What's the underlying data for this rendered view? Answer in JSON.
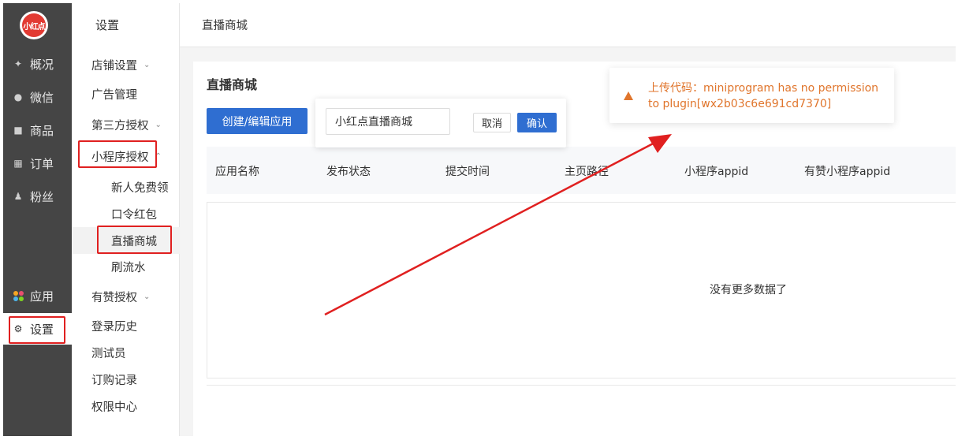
{
  "app": {
    "logo_text": "小红点"
  },
  "left_nav": [
    {
      "label": "概况",
      "icon": "dashboard-icon"
    },
    {
      "label": "微信",
      "icon": "wechat-icon"
    },
    {
      "label": "商品",
      "icon": "goods-icon"
    },
    {
      "label": "订单",
      "icon": "order-icon"
    },
    {
      "label": "粉丝",
      "icon": "fans-icon"
    }
  ],
  "left_nav_bottom": [
    {
      "label": "应用",
      "icon": "apps-icon"
    },
    {
      "label": "设置",
      "icon": "gear-icon"
    }
  ],
  "submenu": {
    "title": "设置",
    "items": [
      {
        "label": "店铺设置",
        "has_chevron": true
      },
      {
        "label": "广告管理"
      },
      {
        "label": "第三方授权",
        "has_chevron": true
      },
      {
        "label": "小程序授权",
        "has_chevron": true
      },
      {
        "label": "新人免费领"
      },
      {
        "label": "口令红包"
      },
      {
        "label": "直播商城",
        "selected": true
      },
      {
        "label": "刷流水"
      },
      {
        "label": "有赞授权",
        "has_chevron": true
      },
      {
        "label": "登录历史"
      },
      {
        "label": "测试员"
      },
      {
        "label": "订购记录"
      },
      {
        "label": "权限中心"
      }
    ]
  },
  "header": {
    "breadcrumb": "直播商城"
  },
  "main": {
    "title": "直播商城",
    "create_button": "创建/编辑应用",
    "popover": {
      "input_value": "小红点直播商城",
      "cancel": "取消",
      "confirm": "确认"
    },
    "table": {
      "columns": [
        "应用名称",
        "发布状态",
        "提交时间",
        "主页路径",
        "小程序appid",
        "有赞小程序appid"
      ],
      "empty_text": "没有更多数据了"
    }
  },
  "toast": {
    "type": "warning",
    "message": "上传代码：miniprogram has no permission to plugin[wx2b03c6e691cd7370]"
  },
  "colors": {
    "primary": "#2f6ed1",
    "warning": "#e0752c",
    "annotation": "#e02020",
    "nav_bg": "#454545"
  }
}
